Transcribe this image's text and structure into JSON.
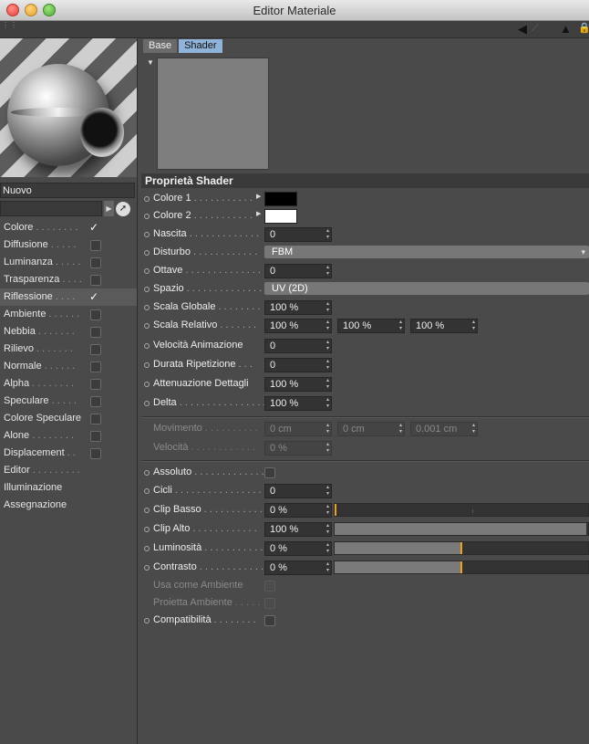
{
  "window": {
    "title": "Editor Materiale"
  },
  "material": {
    "name": "Nuovo"
  },
  "channels": [
    {
      "label": "Colore",
      "dots": " . . . . . . . .",
      "state": "check"
    },
    {
      "label": "Diffusione",
      "dots": " . . . . .",
      "state": "box"
    },
    {
      "label": "Luminanza",
      "dots": " . . . . .",
      "state": "box"
    },
    {
      "label": "Trasparenza",
      "dots": " . . . .",
      "state": "box"
    },
    {
      "label": "Riflessione",
      "dots": " . . . .",
      "state": "check",
      "selected": true
    },
    {
      "label": "Ambiente",
      "dots": " . . . . . .",
      "state": "box"
    },
    {
      "label": "Nebbia",
      "dots": " . . . . . . .",
      "state": "box"
    },
    {
      "label": "Rilievo",
      "dots": " . . . . . . .",
      "state": "box"
    },
    {
      "label": "Normale",
      "dots": " . . . . . .",
      "state": "box"
    },
    {
      "label": "Alpha",
      "dots": " . . . . . . . .",
      "state": "box"
    },
    {
      "label": "Speculare",
      "dots": " . . . . .",
      "state": "box"
    },
    {
      "label": "Colore Speculare",
      "dots": "",
      "state": "box"
    },
    {
      "label": "Alone",
      "dots": " . . . . . . . .",
      "state": "box"
    },
    {
      "label": "Displacement",
      "dots": " . .",
      "state": "box"
    },
    {
      "label": "Editor",
      "dots": " . . . . . . . . .",
      "state": "none"
    },
    {
      "label": "Illuminazione",
      "dots": "",
      "state": "none"
    },
    {
      "label": "Assegnazione",
      "dots": "",
      "state": "none"
    }
  ],
  "tabs": [
    "Base",
    "Shader"
  ],
  "section": {
    "title": "Proprietà Shader"
  },
  "props": {
    "colore1": {
      "label": "Colore 1",
      "dots": " . . . . . . . . . . .",
      "color": "#000000"
    },
    "colore2": {
      "label": "Colore 2",
      "dots": " . . . . . . . . . . .",
      "color": "#ffffff"
    },
    "nascita": {
      "label": "Nascita",
      "dots": " . . . . . . . . . . . . .",
      "value": "0"
    },
    "disturbo": {
      "label": "Disturbo",
      "dots": " . . . . . . . . . . . .",
      "value": "FBM"
    },
    "ottave": {
      "label": "Ottave",
      "dots": " . . . . . . . . . . . . . .",
      "value": "0"
    },
    "spazio": {
      "label": "Spazio",
      "dots": " . . . . . . . . . . . . . .",
      "value": "UV (2D)"
    },
    "scalaGlobale": {
      "label": "Scala Globale",
      "dots": " . . . . . . . .",
      "value": "100 %"
    },
    "scalaRelativo": {
      "label": "Scala Relativo",
      "dots": " . . . . . . .",
      "values": [
        "100 %",
        "100 %",
        "100 %"
      ]
    },
    "velocita": {
      "label": "Velocità Animazione",
      "dots": "",
      "value": "0"
    },
    "durata": {
      "label": "Durata Ripetizione",
      "dots": " . . .",
      "value": "0"
    },
    "attenuazione": {
      "label": "Attenuazione Dettagli",
      "dots": "",
      "value": "100 %"
    },
    "delta": {
      "label": "Delta",
      "dots": " . . . . . . . . . . . . . . . .",
      "value": "100 %"
    },
    "movimento": {
      "label": "Movimento",
      "dots": " . . . . . . . . . .",
      "values": [
        "0 cm",
        "0 cm",
        "0.001 cm"
      ]
    },
    "velocita2": {
      "label": "Velocità",
      "dots": " . . . . . . . . . . . .",
      "value": "0 %"
    },
    "assoluto": {
      "label": "Assoluto",
      "dots": " . . . . . . . . . . . . ."
    },
    "cicli": {
      "label": "Cicli",
      "dots": " . . . . . . . . . . . . . . . . . .",
      "value": "0"
    },
    "clipBasso": {
      "label": "Clip Basso",
      "dots": " . . . . . . . . . . .",
      "value": "0 %",
      "level": 0
    },
    "clipAlto": {
      "label": "Clip Alto",
      "dots": " . . . . . . . . . . . .",
      "value": "100 %",
      "level": 100
    },
    "luminosita": {
      "label": "Luminosità",
      "dots": " . . . . . . . . . . .",
      "value": "0 %",
      "level": 0
    },
    "contrasto": {
      "label": "Contrasto",
      "dots": " . . . . . . . . . . . .",
      "value": "0 %",
      "level": 0
    },
    "usaAmbiente": {
      "label": "Usa come Ambiente",
      "dots": ""
    },
    "proiettaAmbiente": {
      "label": "Proietta Ambiente",
      "dots": " . . . . ."
    },
    "compatibilita": {
      "label": "Compatibilità",
      "dots": " . . . . . . . ."
    }
  },
  "icons": {
    "pick": "pointer-icon",
    "nav_back": "arrow-left-icon",
    "nav_up": "arrow-up-icon",
    "lock": "lock-icon"
  }
}
